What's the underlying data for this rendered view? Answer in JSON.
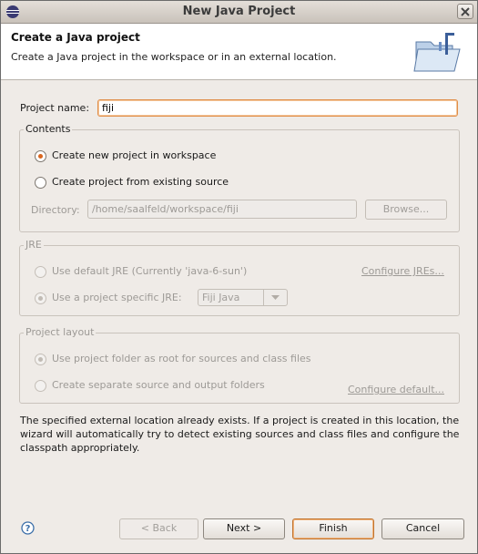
{
  "window": {
    "title": "New Java Project"
  },
  "header": {
    "title": "Create a Java project",
    "description": "Create a Java project in the workspace or in an external location."
  },
  "project_name": {
    "label": "Project name:",
    "value": "fiji"
  },
  "contents": {
    "title": "Contents",
    "option_new": "Create new project in workspace",
    "option_existing": "Create project from existing source",
    "selected": "option_new",
    "directory_label": "Directory:",
    "directory_value": "/home/saalfeld/workspace/fiji",
    "browse_label": "Browse..."
  },
  "jre": {
    "title": "JRE",
    "option_default": "Use default JRE (Currently 'java-6-sun')",
    "configure_link": "Configure JREs...",
    "option_specific": "Use a project specific JRE:",
    "specific_value": "Fiji Java",
    "selected": "option_specific"
  },
  "layout": {
    "title": "Project layout",
    "option_root": "Use project folder as root for sources and class files",
    "option_separate": "Create separate source and output folders",
    "configure_link": "Configure default...",
    "selected": "option_root"
  },
  "note": "The specified external location already exists. If a project is created in this location, the wizard will automatically try to detect existing sources and class files and configure the classpath appropriately.",
  "buttons": {
    "back": "< Back",
    "next": "Next >",
    "finish": "Finish",
    "cancel": "Cancel"
  },
  "colors": {
    "accent": "#d9661f",
    "focus_border": "#e08e4a",
    "disabled_text": "#9d9a96"
  }
}
